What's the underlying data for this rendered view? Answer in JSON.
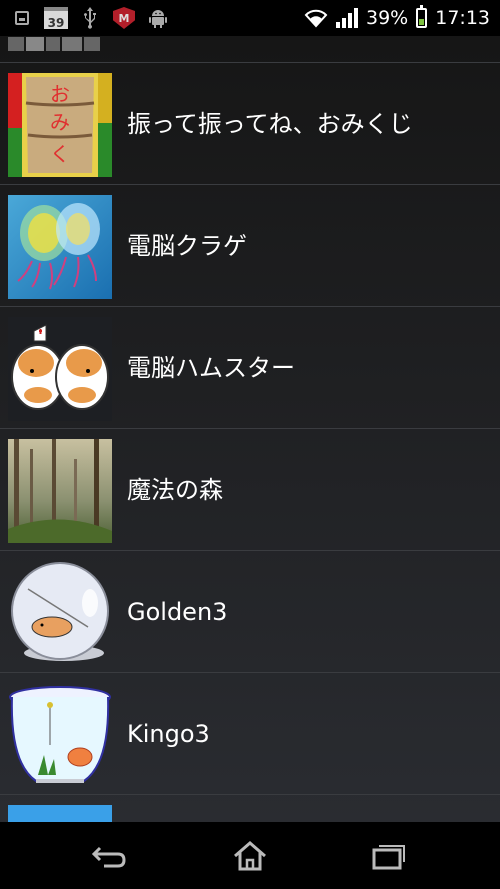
{
  "status_bar": {
    "notification_badge": "39",
    "mcafee_letter": "M",
    "battery": "39%",
    "time": "17:13"
  },
  "apps": [
    {
      "label": "振って振ってね、おみくじ",
      "icon": "omikuji-box-icon"
    },
    {
      "label": "電脳クラゲ",
      "icon": "jellyfish-bulb-icon"
    },
    {
      "label": "電脳ハムスター",
      "icon": "hamster-icon"
    },
    {
      "label": "魔法の森",
      "icon": "forest-icon"
    },
    {
      "label": "Golden3",
      "icon": "hamster-ball-icon"
    },
    {
      "label": "Kingo3",
      "icon": "fishbowl-icon"
    }
  ],
  "colors": {
    "background": "#1c1e22",
    "separator": "#3a3c40",
    "battery_fill": "#7fc241"
  }
}
